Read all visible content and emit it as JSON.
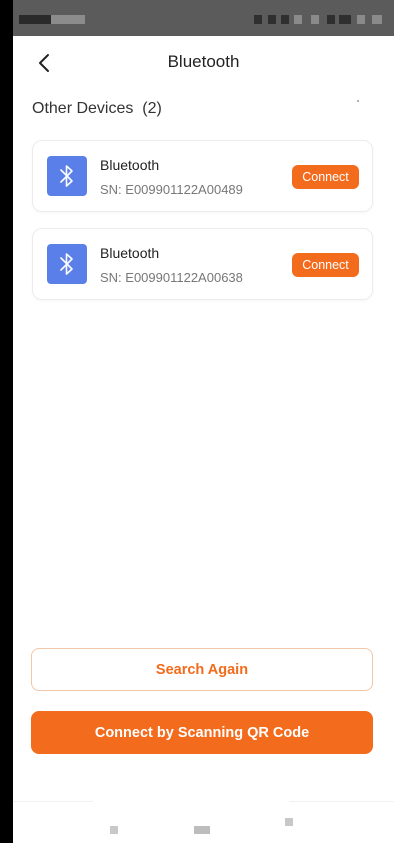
{
  "nav": {
    "title": "Bluetooth"
  },
  "section": {
    "title": "Other Devices  (2)"
  },
  "devices": [
    {
      "name": "Bluetooth",
      "sn": "SN: E009901122A00489",
      "action": "Connect"
    },
    {
      "name": "Bluetooth",
      "sn": "SN: E009901122A00638",
      "action": "Connect"
    }
  ],
  "actions": {
    "search_again": "Search Again",
    "scan_qr": "Connect by Scanning QR Code"
  },
  "icons": {
    "back": "chevron-left-icon",
    "device": "bluetooth-icon"
  },
  "colors": {
    "accent": "#f36b1c",
    "bluetooth_tile": "#5b7fe8"
  }
}
